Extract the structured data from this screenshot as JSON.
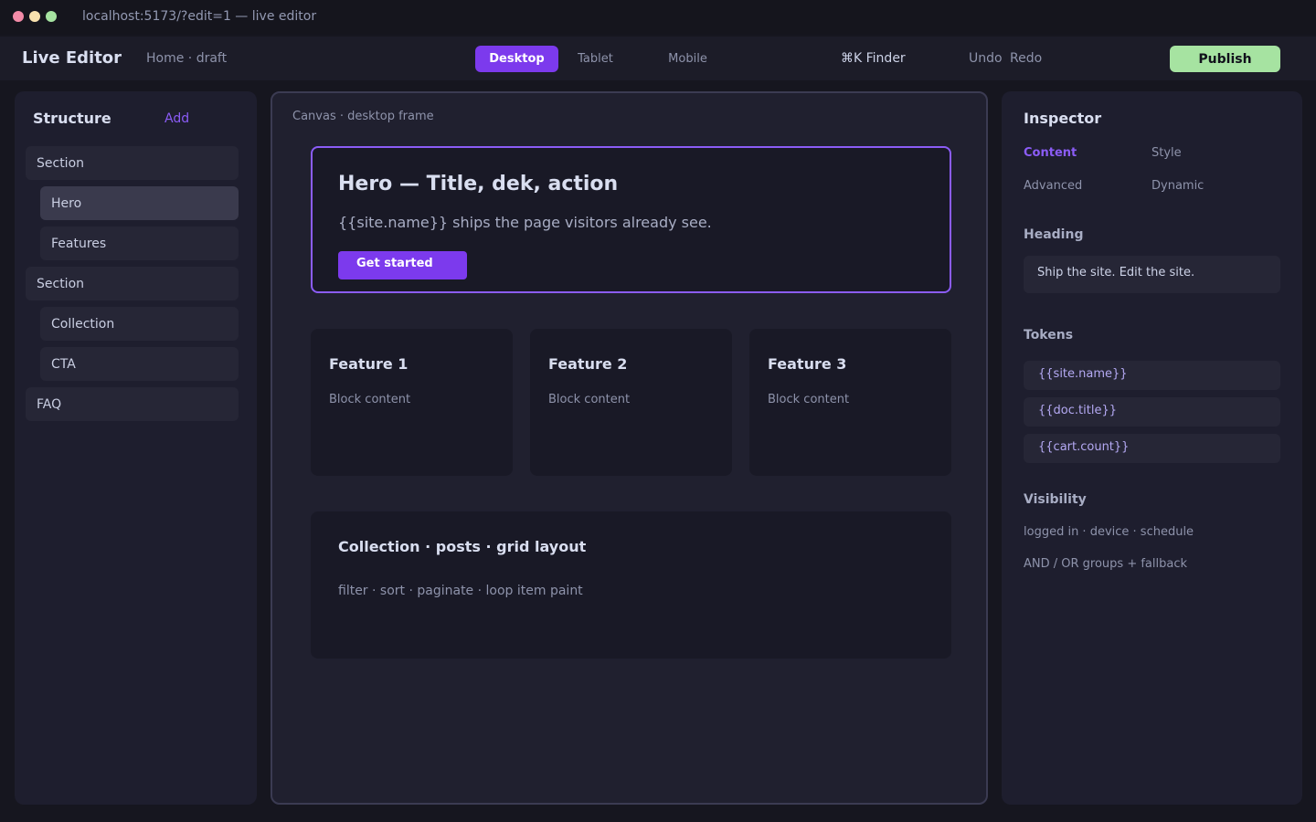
{
  "window": {
    "url": "localhost:5173/?edit=1 — live editor"
  },
  "toolbar": {
    "app_title": "Live Editor",
    "breadcrumb": "Home · draft",
    "devices": [
      "Desktop",
      "Tablet",
      "Mobile"
    ],
    "active_device": "Desktop",
    "finder": "⌘K Finder",
    "undo": "Undo",
    "redo": "Redo",
    "publish": "Publish"
  },
  "structure": {
    "title": "Structure",
    "add_label": "Add",
    "items": [
      {
        "label": "Section",
        "level": 0
      },
      {
        "label": "Hero",
        "level": 1,
        "selected": true
      },
      {
        "label": "Features",
        "level": 1
      },
      {
        "label": "Section",
        "level": 0
      },
      {
        "label": "Collection",
        "level": 1
      },
      {
        "label": "CTA",
        "level": 1
      },
      {
        "label": "FAQ",
        "level": 0
      }
    ]
  },
  "canvas": {
    "label": "Canvas · desktop frame",
    "hero": {
      "title": "Hero — Title, dek, action",
      "dek": "{{site.name}} ships the page visitors already see.",
      "cta": "Get started"
    },
    "features": [
      {
        "title": "Feature 1",
        "body": "Block content"
      },
      {
        "title": "Feature 2",
        "body": "Block content"
      },
      {
        "title": "Feature 3",
        "body": "Block content"
      }
    ],
    "collection": {
      "title": "Collection · posts · grid layout",
      "subtitle": "filter · sort · paginate · loop item paint"
    }
  },
  "inspector": {
    "title": "Inspector",
    "tabs": [
      "Content",
      "Style",
      "Advanced",
      "Dynamic"
    ],
    "active_tab": "Content",
    "heading_label": "Heading",
    "heading_value": "Ship the site. Edit the site.",
    "tokens_label": "Tokens",
    "tokens": [
      "{{site.name}}",
      "{{doc.title}}",
      "{{cart.count}}"
    ],
    "visibility_label": "Visibility",
    "visibility_lines": [
      "logged in · device · schedule",
      "AND / OR groups + fallback"
    ]
  },
  "colors": {
    "accent": "#7c3aed",
    "accent_text": "#8b5cf6",
    "publish": "#a6e3a1"
  }
}
